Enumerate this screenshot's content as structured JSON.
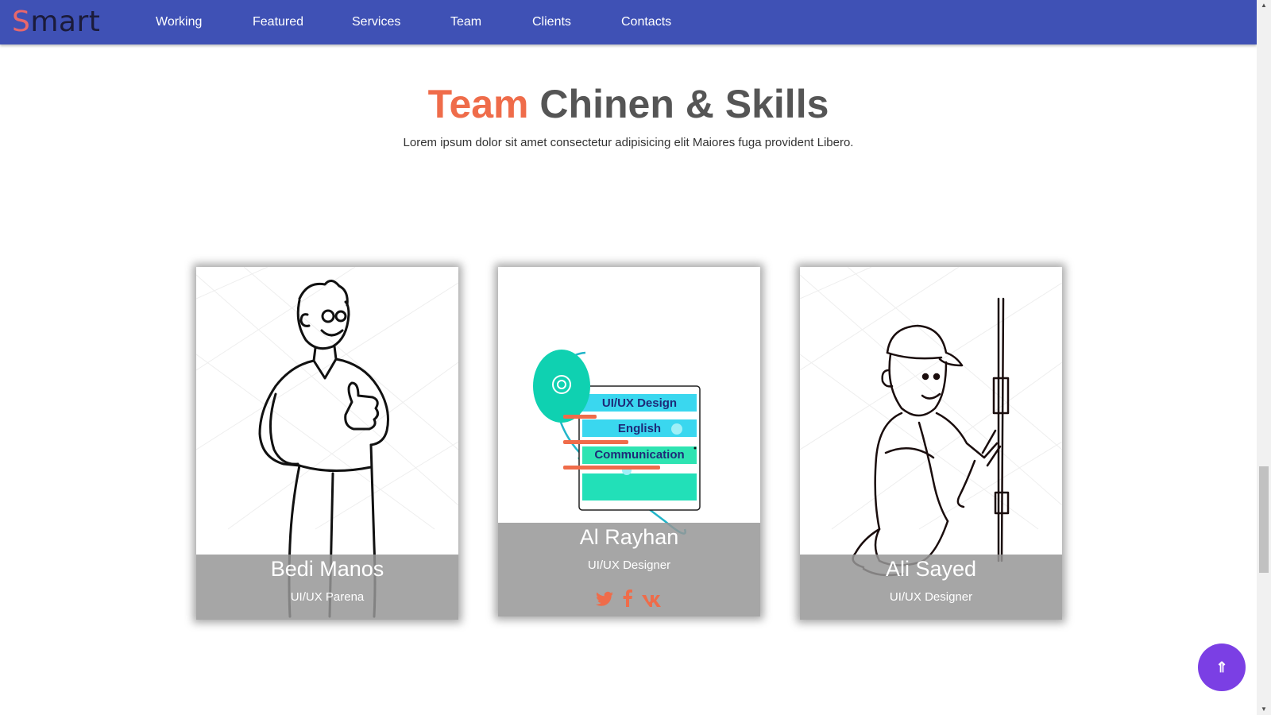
{
  "navbar": {
    "logo_first": "S",
    "logo_rest": "mart",
    "items": [
      "Working",
      "Featured",
      "Services",
      "Team",
      "Clients",
      "Contacts"
    ]
  },
  "section": {
    "title_accent": "Team",
    "title_rest": "Chinen & Skills",
    "subtitle": "Lorem ipsum dolor sit amet consectetur adipisicing elit Maiores fuga provident Libero."
  },
  "cards": [
    {
      "name": "Bedi Manos",
      "role": "UI/UX Parena",
      "art": "man-thumbs-up-sketch"
    },
    {
      "name": "Al Rayhan",
      "role": "UI/UX Designer",
      "art": "skills-illustration",
      "skills": [
        "UI/UX Design",
        "English",
        "Communication"
      ],
      "socials": [
        "twitter-icon",
        "facebook-icon",
        "vk-icon"
      ]
    },
    {
      "name": "Ali Sayed",
      "role": "UI/UX Designer",
      "art": "worker-sketch"
    }
  ],
  "back_to_top": {
    "glyph": "⇑"
  },
  "colors": {
    "navbar": "#3f51b5",
    "accent": "#ef6c4a",
    "back_to_top": "#7b3fe4",
    "card_overlay": "#969696"
  }
}
